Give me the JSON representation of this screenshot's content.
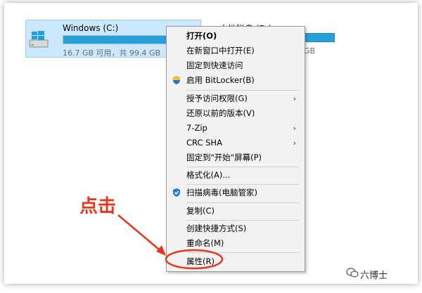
{
  "drive": {
    "name": "Windows (C:)",
    "info": "16.7 GB 可用，共 99.4 GB",
    "used_fraction": 0.83
  },
  "drive2": {
    "name": "本地磁盘 (D:)",
    "info": "GB"
  },
  "menu": {
    "items": [
      {
        "label": "打开(O)",
        "bold": true
      },
      {
        "label": "在新窗口中打开(E)"
      },
      {
        "label": "固定到快速访问"
      },
      {
        "label": "启用 BitLocker(B)",
        "icon": "shield-icon"
      },
      {
        "label": "授予访问权限(G)",
        "submenu": true
      },
      {
        "label": "还原以前的版本(V)"
      },
      {
        "label": "7-Zip",
        "submenu": true
      },
      {
        "label": "CRC SHA",
        "submenu": true
      },
      {
        "label": "固定到\"开始\"屏幕(P)"
      },
      {
        "label": "格式化(A)..."
      },
      {
        "label": "扫描病毒(电脑管家)",
        "icon": "antivirus-shield-icon"
      },
      {
        "label": "复制(C)"
      },
      {
        "label": "创建快捷方式(S)"
      },
      {
        "label": "重命名(M)"
      },
      {
        "label": "属性(R)"
      }
    ],
    "submenu_arrow": "›"
  },
  "annotation": {
    "text": "点击",
    "color": "#e8361d"
  },
  "watermark": {
    "text": "六博士"
  },
  "colors": {
    "selection_bg": "#cce8ff",
    "bar_fill": "#26a0da",
    "menu_bg": "#f2f2f2"
  }
}
